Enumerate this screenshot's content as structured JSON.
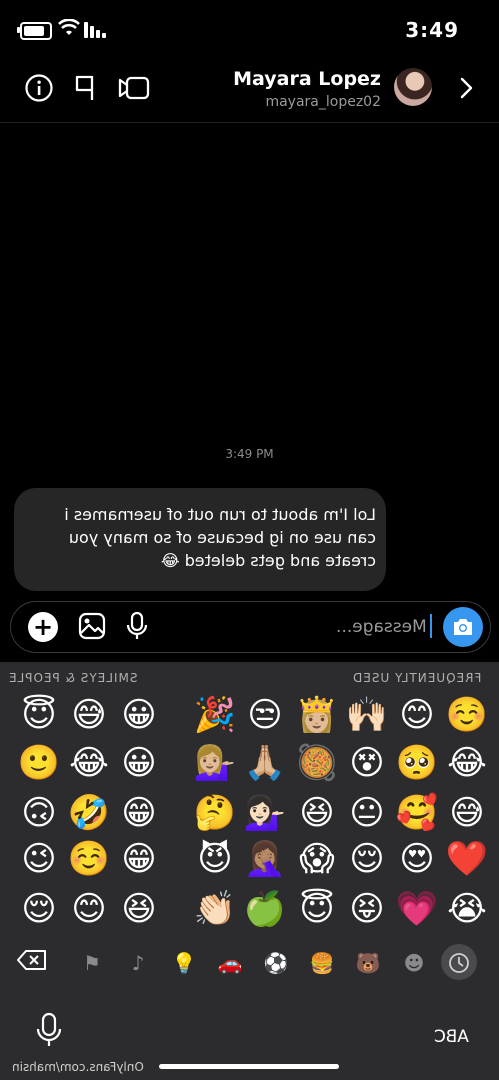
{
  "status_bar": {
    "time": "3:49"
  },
  "header": {
    "name": "Mayara Lopez",
    "handle": "mayara_lopez02"
  },
  "conversation": {
    "timestamp": "3:49 PM",
    "message": "Lol I'm about to run out of usernames i can use on ig because of so many you create and gets deleted 😂"
  },
  "composer": {
    "placeholder": "Message..."
  },
  "keyboard": {
    "frequently_used_label": "FREQUENTLY USED",
    "smileys_label": "SMILEYS & PEOPLE",
    "frequent_grid": [
      [
        "☺️",
        "😊",
        "🙌🏻",
        "👸🏼",
        "😒",
        "🎉"
      ],
      [
        "😂",
        "🥺",
        "😵",
        "🥘",
        "🙏🏼",
        "💁🏼‍♀️"
      ],
      [
        "😅",
        "🥰",
        "😐",
        "😆",
        "💁🏻‍♀️",
        "🤔"
      ],
      [
        "❤️",
        "😍",
        "😌",
        "😱",
        "🤦🏽‍♀️",
        "😈"
      ],
      [
        "😭",
        "💗",
        "😝",
        "😇",
        "🍏",
        "👏🏻"
      ]
    ],
    "smileys_grid": [
      [
        "😀",
        "😅",
        "😇"
      ],
      [
        "😀",
        "😂",
        "🙂"
      ],
      [
        "😁",
        "🤣",
        "🙃"
      ],
      [
        "😁",
        "☺️",
        "😉"
      ],
      [
        "😆",
        "😊",
        "😌"
      ]
    ],
    "abc_label": "ABC"
  },
  "watermark": "OnlyFans.com/mahsin"
}
